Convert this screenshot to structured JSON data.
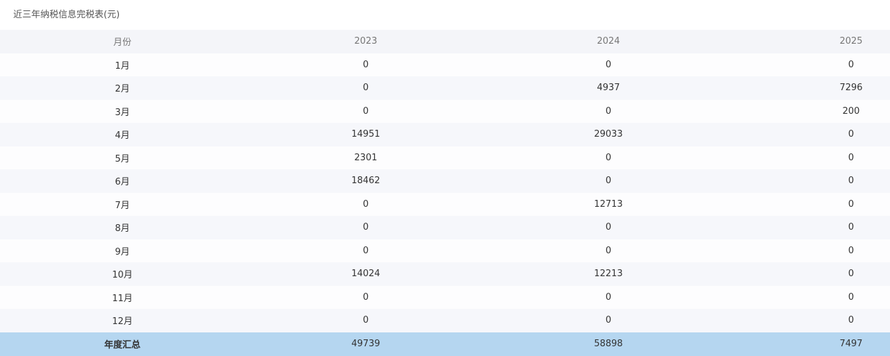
{
  "table_title": "近三年纳税信息完税表(元)",
  "columns": {
    "month": "月份",
    "y2023": "2023",
    "y2024": "2024",
    "y2025": "2025"
  },
  "rows": [
    {
      "month": "1月",
      "y2023": "0",
      "y2024": "0",
      "y2025": "0"
    },
    {
      "month": "2月",
      "y2023": "0",
      "y2024": "4937",
      "y2025": "7296"
    },
    {
      "month": "3月",
      "y2023": "0",
      "y2024": "0",
      "y2025": "200"
    },
    {
      "month": "4月",
      "y2023": "14951",
      "y2024": "29033",
      "y2025": "0"
    },
    {
      "month": "5月",
      "y2023": "2301",
      "y2024": "0",
      "y2025": "0"
    },
    {
      "month": "6月",
      "y2023": "18462",
      "y2024": "0",
      "y2025": "0"
    },
    {
      "month": "7月",
      "y2023": "0",
      "y2024": "12713",
      "y2025": "0"
    },
    {
      "month": "8月",
      "y2023": "0",
      "y2024": "0",
      "y2025": "0"
    },
    {
      "month": "9月",
      "y2023": "0",
      "y2024": "0",
      "y2025": "0"
    },
    {
      "month": "10月",
      "y2023": "14024",
      "y2024": "12213",
      "y2025": "0"
    },
    {
      "month": "11月",
      "y2023": "0",
      "y2024": "0",
      "y2025": "0"
    },
    {
      "month": "12月",
      "y2023": "0",
      "y2024": "0",
      "y2025": "0"
    }
  ],
  "total": {
    "label": "年度汇总",
    "y2023": "49739",
    "y2024": "58898",
    "y2025": "7497"
  },
  "colors": {
    "header_bg": "#f4f5f9",
    "alt_row_bg": "#f6f7fb",
    "total_row_bg": "#b5d6f0"
  }
}
